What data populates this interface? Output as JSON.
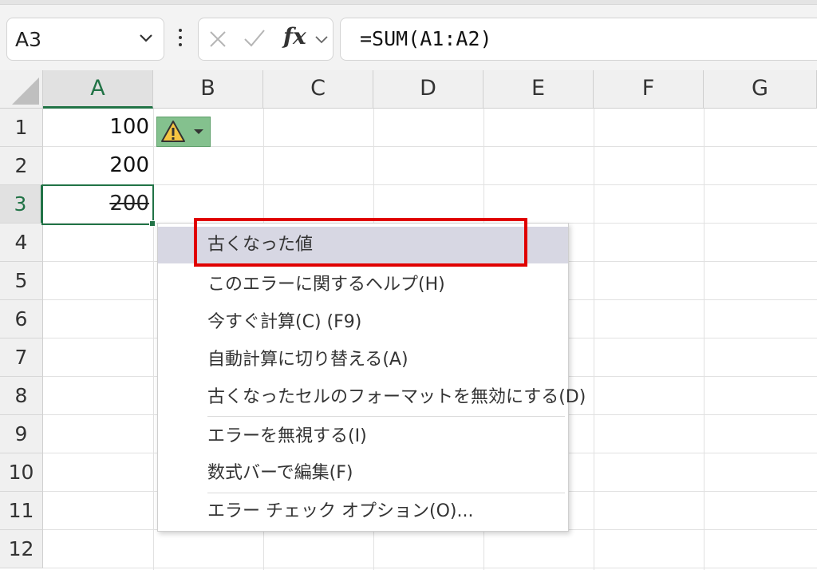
{
  "formula_bar": {
    "name_box": "A3",
    "fx_label": "fx",
    "formula": "=SUM(A1:A2)"
  },
  "columns": [
    "A",
    "B",
    "C",
    "D",
    "E",
    "F",
    "G"
  ],
  "rows": [
    "1",
    "2",
    "3",
    "4",
    "5",
    "6",
    "7",
    "8",
    "9",
    "10",
    "11",
    "12"
  ],
  "cells": {
    "A1": "100",
    "A2": "200",
    "A3": "200"
  },
  "selected": {
    "column": "A",
    "row": "3"
  },
  "context_menu": {
    "items": [
      "古くなった値",
      "このエラーに関するヘルプ(H)",
      "今すぐ計算(C) (F9)",
      "自動計算に切り替える(A)",
      "古くなったセルのフォーマットを無効にする(D)",
      "エラーを無視する(I)",
      "数式バーで編集(F)",
      "エラー チェック オプション(O)..."
    ]
  },
  "colors": {
    "accent_green": "#217346",
    "warning_tag": "#84c18e",
    "highlight_red": "#e00000",
    "menu_header": "#d7d7e3"
  }
}
